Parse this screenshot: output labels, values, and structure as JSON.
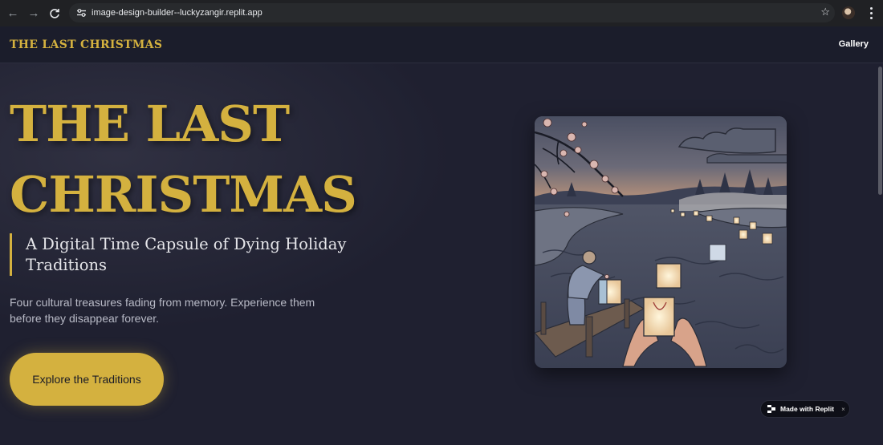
{
  "browser": {
    "url": "image-design-builder--luckyzangir.replit.app"
  },
  "header": {
    "brand": "THE LAST CHRISTMAS",
    "nav_gallery": "Gallery"
  },
  "hero": {
    "title_line1": "THE LAST",
    "title_line2": "CHRISTMAS",
    "subtitle": "A Digital Time Capsule of Dying Holiday Traditions",
    "description": "Four cultural treasures fading from memory. Experience them before they disappear forever.",
    "cta": "Explore the Traditions"
  },
  "badge": {
    "label": "Made with Replit",
    "close": "×"
  },
  "colors": {
    "accent": "#d4b13f",
    "background": "#1f2030",
    "header_bg": "#1b1d2b"
  },
  "icons": [
    "back-arrow-icon",
    "forward-arrow-icon",
    "reload-icon",
    "site-settings-icon",
    "star-icon",
    "profile-avatar",
    "more-menu-icon",
    "replit-logo-icon",
    "close-icon"
  ]
}
